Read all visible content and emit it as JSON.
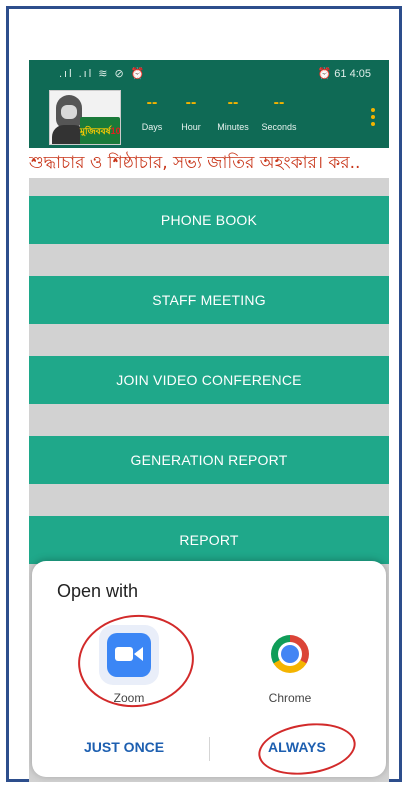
{
  "status_bar": {
    "left_icons": ".ıl .ıl ≋ ⊘ ⏰",
    "right_text": "⏰ 61 4:05"
  },
  "header": {
    "logo_icon": "mujib-portrait-logo",
    "logo_text": "মুজিববর্ষ",
    "logo_number": "100",
    "countdown": [
      {
        "value": "--",
        "label": "Days"
      },
      {
        "value": "--",
        "label": "Hour"
      },
      {
        "value": "--",
        "label": "Minutes"
      },
      {
        "value": "--",
        "label": "Seconds"
      }
    ],
    "menu_icon": "overflow-menu-icon"
  },
  "marquee_text": "শুদ্ধাচার ও শিষ্ঠাচার, সভ্য জাতির অহংকার। কর..",
  "menu_buttons": [
    {
      "label": "PHONE BOOK"
    },
    {
      "label": "STAFF MEETING"
    },
    {
      "label": "JOIN VIDEO CONFERENCE"
    },
    {
      "label": "GENERATION REPORT"
    },
    {
      "label": "REPORT"
    }
  ],
  "open_with": {
    "title": "Open with",
    "apps": [
      {
        "name": "Zoom",
        "icon": "zoom-camera-icon"
      },
      {
        "name": "Chrome",
        "icon": "chrome-icon"
      }
    ],
    "just_once": "JUST ONCE",
    "always": "ALWAYS"
  },
  "colors": {
    "header_green": "#0f6a55",
    "button_teal": "#1fa88a",
    "marquee_red": "#c8361a",
    "action_blue": "#1d5fb0",
    "annotation_red": "#d22a2a"
  }
}
